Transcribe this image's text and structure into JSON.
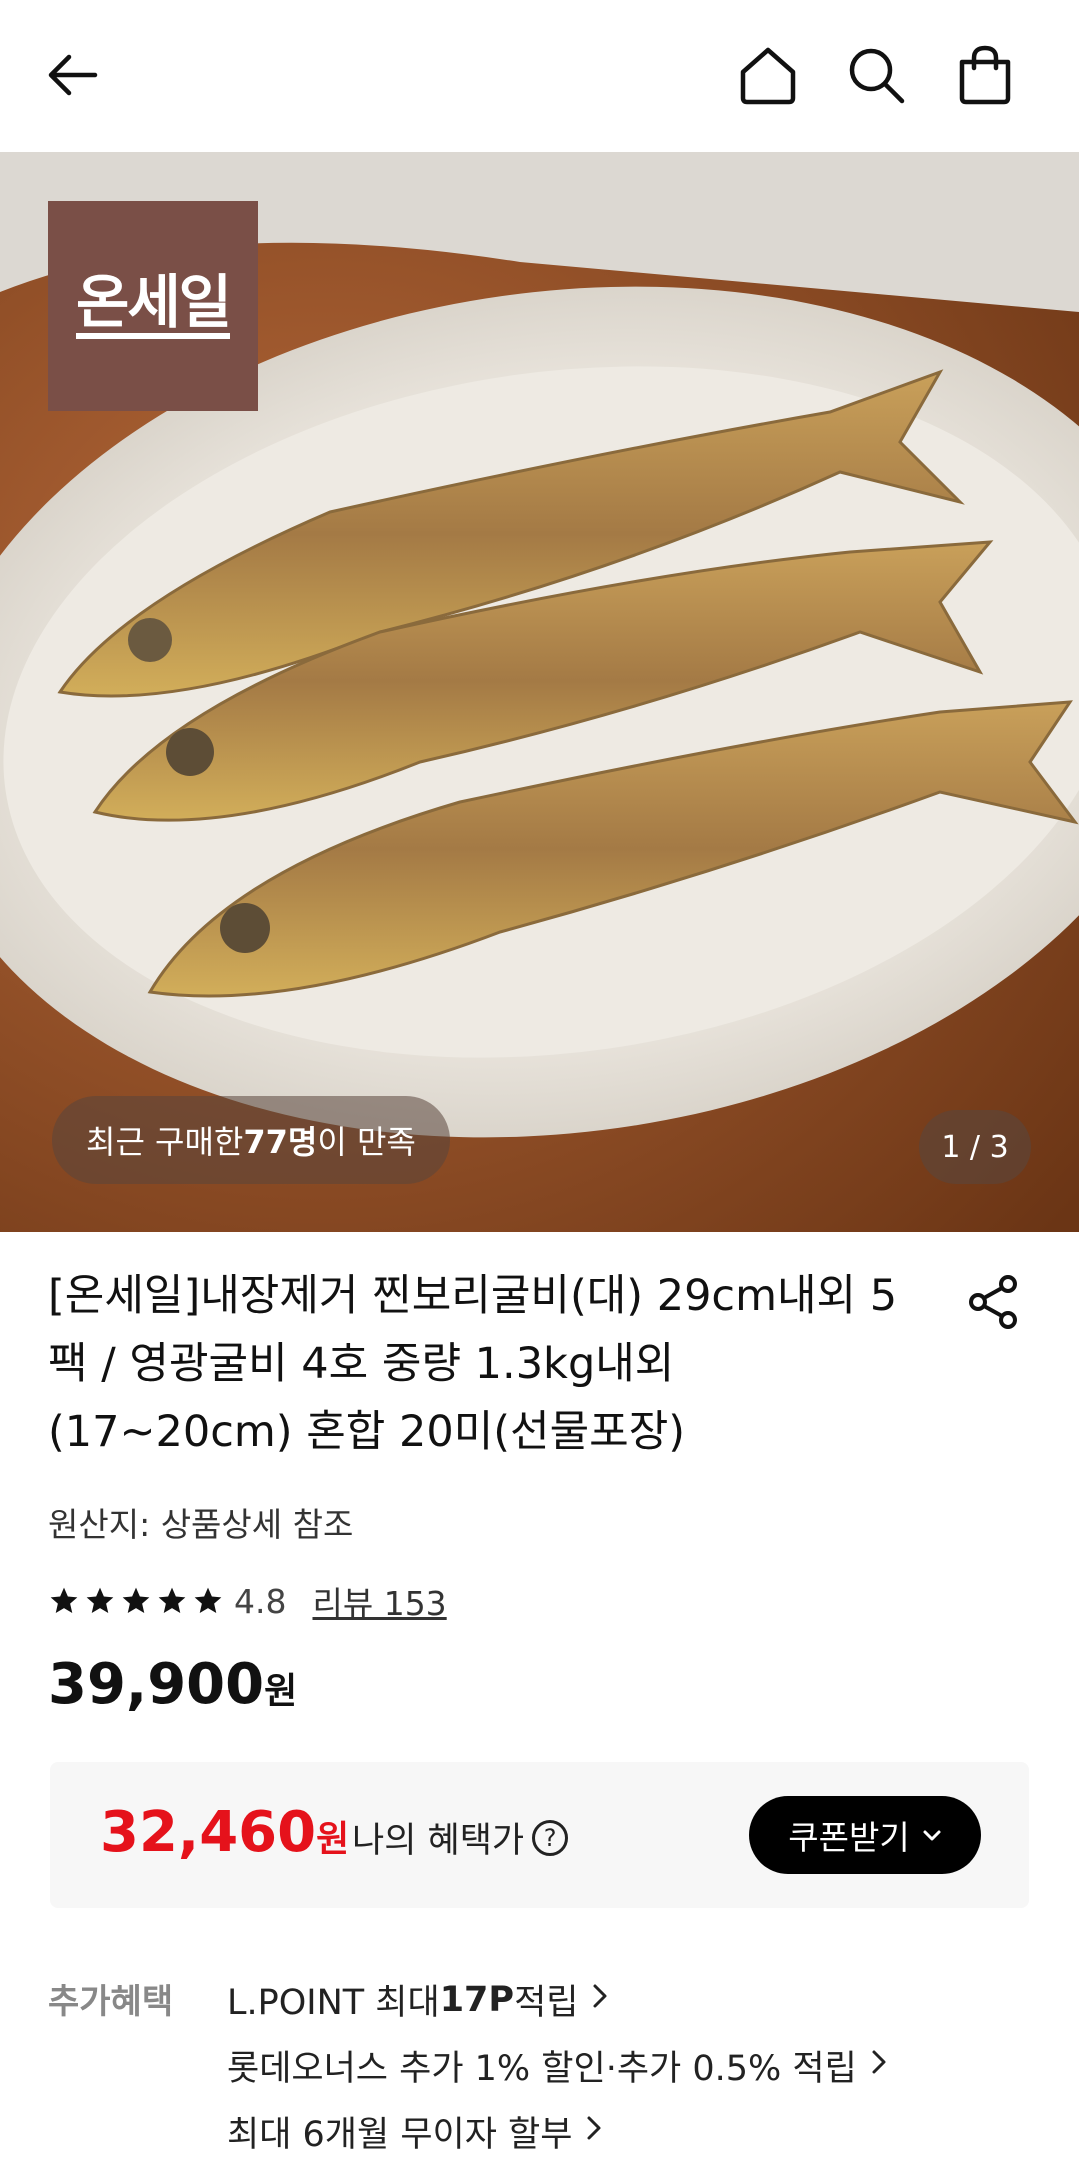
{
  "header": {
    "back_icon": "arrow-left-icon",
    "home_icon": "home-icon",
    "search_icon": "search-icon",
    "cart_icon": "shopping-bag-icon"
  },
  "hero": {
    "brand_badge": "온세일",
    "buyers_prefix": "최근 구매한 ",
    "buyers_count": "77명",
    "buyers_suffix": "이 만족",
    "page_counter": "1 / 3",
    "badge_color": "#7a4f47"
  },
  "product": {
    "title": "[온세일]내장제거 찐보리굴비(대) 29cm내외 5팩 / 영광굴비 4호 중량 1.3kg내외(17~20cm) 혼합 20미(선물포장)",
    "origin": "원산지: 상품상세 참조",
    "rating": "4.8",
    "reviews": "리뷰 153",
    "price": "39,900",
    "price_unit": "원"
  },
  "benefit": {
    "price": "32,460",
    "price_unit": "원",
    "label": "나의 혜택가",
    "help_icon": "question-circle-icon",
    "coupon_button": "쿠폰받기",
    "accent": "#e5121b"
  },
  "extra": {
    "label": "추가혜택",
    "items": [
      {
        "text_a": "L.POINT 최대 ",
        "text_b": "17P",
        "text_c": " 적립"
      },
      {
        "text_a": "롯데오너스 추가 1% 할인·추가 0.5% 적립",
        "text_b": "",
        "text_c": ""
      },
      {
        "text_a": "최대 6개월 무이자 할부",
        "text_b": "",
        "text_c": ""
      }
    ]
  }
}
